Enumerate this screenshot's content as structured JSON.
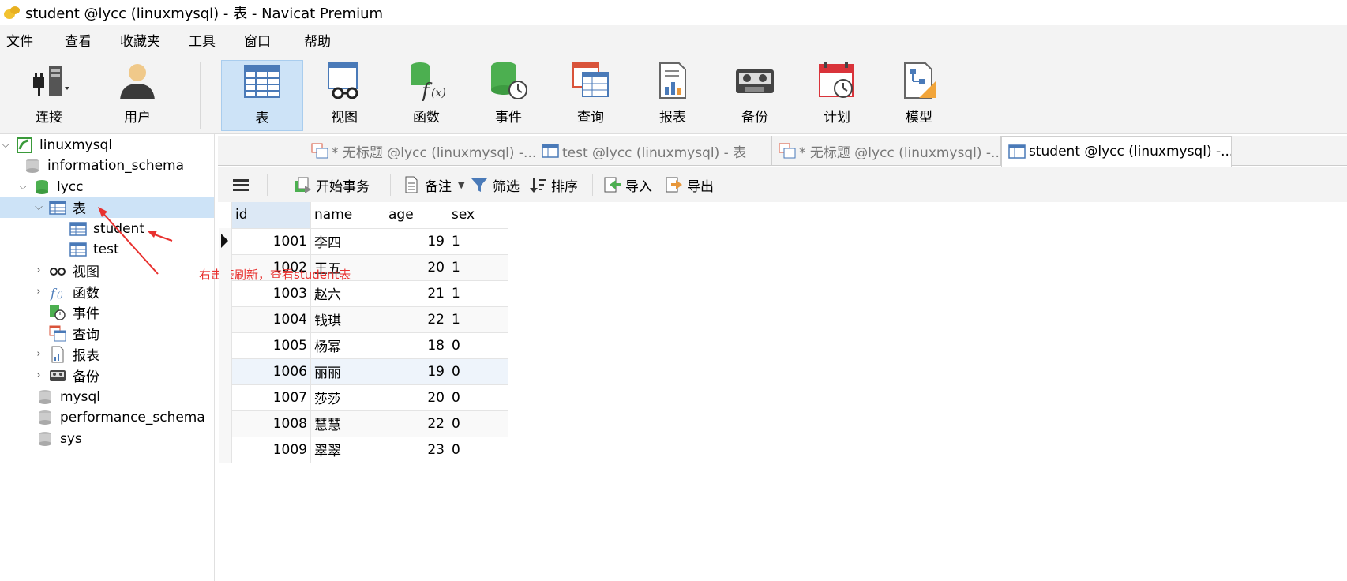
{
  "window": {
    "title": "student @lycc (linuxmysql) - 表 - Navicat Premium"
  },
  "menu": [
    "文件",
    "查看",
    "收藏夹",
    "工具",
    "窗口",
    "帮助"
  ],
  "toolbar": {
    "connect": "连接",
    "user": "用户",
    "table": "表",
    "view": "视图",
    "function": "函数",
    "event": "事件",
    "query": "查询",
    "report": "报表",
    "backup": "备份",
    "schedule": "计划",
    "model": "模型"
  },
  "tree": {
    "connection": "linuxmysql",
    "db_information_schema": "information_schema",
    "db_lycc": "lycc",
    "tables_group": "表",
    "table_student": "student",
    "table_test": "test",
    "views": "视图",
    "functions": "函数",
    "events": "事件",
    "queries": "查询",
    "reports": "报表",
    "backups": "备份",
    "db_mysql": "mysql",
    "db_performance_schema": "performance_schema",
    "db_sys": "sys"
  },
  "tabs": [
    {
      "label": "* 无标题 @lycc (linuxmysql) -..."
    },
    {
      "label": "test @lycc (linuxmysql) - 表"
    },
    {
      "label": "* 无标题 @lycc (linuxmysql) -..."
    },
    {
      "label": "student @lycc (linuxmysql) -..."
    }
  ],
  "subtoolbar": {
    "begin_transaction": "开始事务",
    "note": "备注",
    "filter": "筛选",
    "sort": "排序",
    "import": "导入",
    "export": "导出"
  },
  "grid": {
    "columns": [
      "id",
      "name",
      "age",
      "sex"
    ],
    "rows": [
      [
        "1001",
        "李四",
        "19",
        "1"
      ],
      [
        "1002",
        "王五",
        "20",
        "1"
      ],
      [
        "1003",
        "赵六",
        "21",
        "1"
      ],
      [
        "1004",
        "钱琪",
        "22",
        "1"
      ],
      [
        "1005",
        "杨幂",
        "18",
        "0"
      ],
      [
        "1006",
        "丽丽",
        "19",
        "0"
      ],
      [
        "1007",
        "莎莎",
        "20",
        "0"
      ],
      [
        "1008",
        "慧慧",
        "22",
        "0"
      ],
      [
        "1009",
        "翠翠",
        "23",
        "0"
      ]
    ]
  },
  "annotation": {
    "text": "右击表刷新，查看student表",
    "color": "#e8312f"
  },
  "colors": {
    "selection": "#cde3f7",
    "chrome": "#f3f3f3"
  }
}
